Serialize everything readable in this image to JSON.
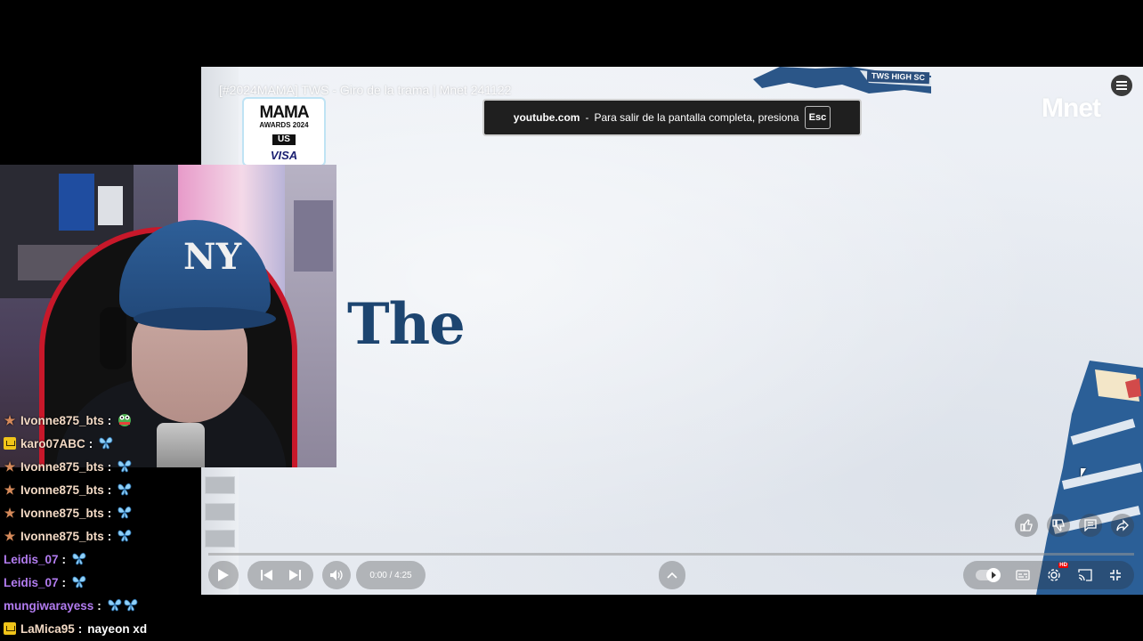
{
  "video": {
    "title": "[#2024MAMA] TWS - Giro de la trama | Mnet 241122",
    "lyric_text": "The",
    "mama_logo": {
      "line1": "MAMA",
      "line2": "AWARDS 2024",
      "line3": "US",
      "line4": "VISA"
    },
    "tws_label": "TWS HIGH SC",
    "channel_logo": "Mnet",
    "fullscreen_toast": {
      "domain": "youtube.com",
      "separator": "-",
      "message": "Para salir de la pantalla completa, presiona",
      "key": "Esc"
    },
    "progress_fraction": 0.0,
    "time": "0:00 / 4:25",
    "icons": {
      "queue": "queue-icon",
      "play": "play-icon",
      "prev": "previous-icon",
      "next": "next-icon",
      "volume": "volume-icon",
      "chevron": "chevron-up-icon",
      "autoplay": "autoplay-toggle-icon",
      "captions": "captions-icon",
      "settings": "settings-icon",
      "cast": "cast-icon",
      "exit_fullscreen": "exit-fullscreen-icon",
      "like": "like-icon",
      "dislike": "dislike-icon",
      "comments": "comments-icon",
      "share": "share-icon"
    },
    "colors": {
      "lyric": "#1d4570",
      "toast_bg": "#1f1f1f",
      "hd_badge": "#e00000"
    }
  },
  "chat": {
    "messages": [
      {
        "badge": "star",
        "user": "Ivonne875_bts",
        "colon": ":",
        "color": "orange",
        "emote": "frog"
      },
      {
        "badge": "crown",
        "user": "karo07ABC",
        "colon": ":",
        "color": "orange",
        "emote": "butterfly"
      },
      {
        "badge": "star",
        "user": "Ivonne875_bts",
        "colon": ":",
        "color": "orange",
        "emote": "butterfly"
      },
      {
        "badge": "star",
        "user": "Ivonne875_bts",
        "colon": ":",
        "color": "orange",
        "emote": "butterfly"
      },
      {
        "badge": "star",
        "user": "Ivonne875_bts",
        "colon": ":",
        "color": "orange",
        "emote": "butterfly"
      },
      {
        "badge": "star",
        "user": "Ivonne875_bts",
        "colon": ":",
        "color": "orange",
        "emote": "butterfly"
      },
      {
        "badge": "none",
        "user": "Leidis_07",
        "colon": ":",
        "color": "purple",
        "emote": "butterfly"
      },
      {
        "badge": "none",
        "user": "Leidis_07",
        "colon": ":",
        "color": "purple",
        "emote": "butterfly"
      },
      {
        "badge": "none",
        "user": "mungiwarayess",
        "colon": ":",
        "color": "purple",
        "emote": "butterfly2"
      },
      {
        "badge": "crown",
        "user": "LaMica95",
        "colon": ":",
        "color": "orange",
        "text": "nayeon xd"
      }
    ]
  }
}
